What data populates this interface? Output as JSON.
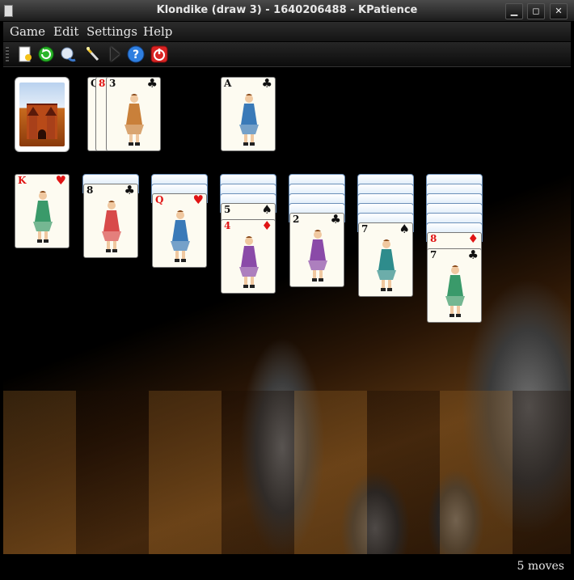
{
  "window": {
    "title": "Klondike (draw 3) - 1640206488 - KPatience",
    "minimize": "▁",
    "maximize": "◻",
    "close": "✕"
  },
  "menu": {
    "game": "Game",
    "edit": "Edit",
    "settings": "Settings",
    "help": "Help"
  },
  "toolbar": [
    "new-game-icon",
    "restart-icon",
    "hint-icon",
    "magic-wand-icon",
    "demo-play-icon",
    "help-icon",
    "quit-icon"
  ],
  "waste": {
    "cards": [
      {
        "rank": "Q",
        "suit": "clubs"
      },
      {
        "rank": "8",
        "suit": "hearts"
      },
      {
        "rank": "3",
        "suit": "clubs"
      }
    ]
  },
  "foundation": [
    {
      "rank": "A",
      "suit": "clubs"
    }
  ],
  "tableau": [
    {
      "face_down": 0,
      "face_up": [
        {
          "rank": "K",
          "suit": "hearts"
        }
      ]
    },
    {
      "face_down": 1,
      "face_up": [
        {
          "rank": "8",
          "suit": "clubs"
        }
      ]
    },
    {
      "face_down": 2,
      "face_up": [
        {
          "rank": "Q",
          "suit": "hearts"
        }
      ]
    },
    {
      "face_down": 3,
      "face_up": [
        {
          "rank": "5",
          "suit": "spades"
        },
        {
          "rank": "4",
          "suit": "diamonds"
        }
      ]
    },
    {
      "face_down": 4,
      "face_up": [
        {
          "rank": "2",
          "suit": "clubs"
        }
      ]
    },
    {
      "face_down": 5,
      "face_up": [
        {
          "rank": "7",
          "suit": "spades"
        }
      ]
    },
    {
      "face_down": 6,
      "face_up": [
        {
          "rank": "8",
          "suit": "diamonds"
        },
        {
          "rank": "7",
          "suit": "clubs"
        }
      ]
    }
  ],
  "status": {
    "moves": "5 moves"
  },
  "colors": {
    "red_suit": "#e01414",
    "black_suit": "#111111",
    "card_back": "#c7dff5"
  }
}
